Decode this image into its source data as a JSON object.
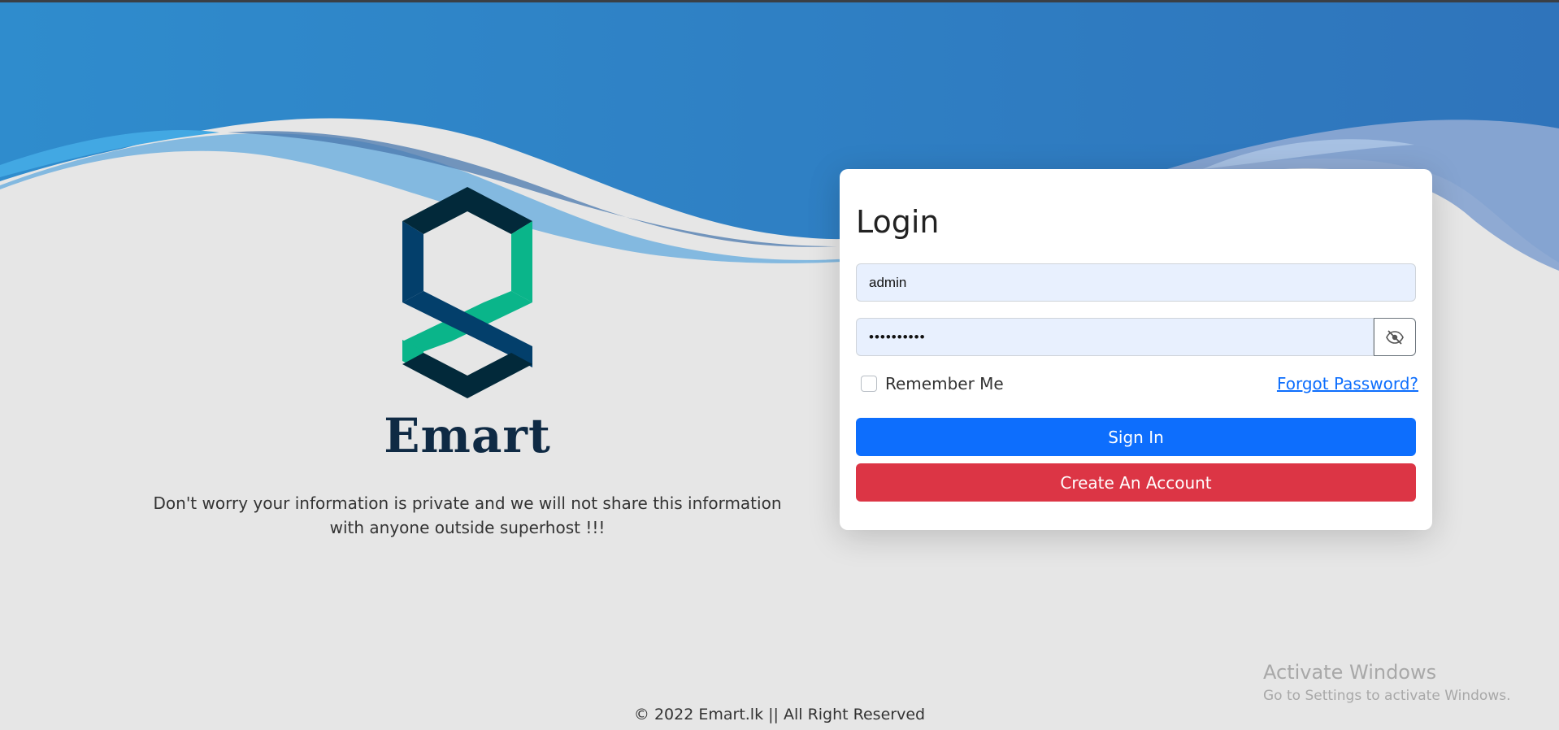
{
  "brand": {
    "name": "Emart",
    "privacy_text": "Don't worry your information is private and we will not share this information with anyone outside superhost !!!"
  },
  "login": {
    "title": "Login",
    "username_value": "admin",
    "password_value": "••••••••••",
    "remember_label": "Remember Me",
    "forgot_label": "Forgot Password?",
    "signin_label": "Sign In",
    "create_label": "Create An Account"
  },
  "footer": {
    "text": "© 2022 Emart.lk || All Right Reserved"
  },
  "watermark": {
    "line1": "Activate Windows",
    "line2": "Go to Settings to activate Windows."
  },
  "icons": {
    "password_toggle": "eye-slash-icon"
  },
  "colors": {
    "primary": "#0d6efd",
    "danger": "#dc3545",
    "wave_blue": "#2d85c8",
    "logo_dark": "#02293a",
    "logo_navy": "#033f6b",
    "logo_green": "#0ab58a"
  }
}
